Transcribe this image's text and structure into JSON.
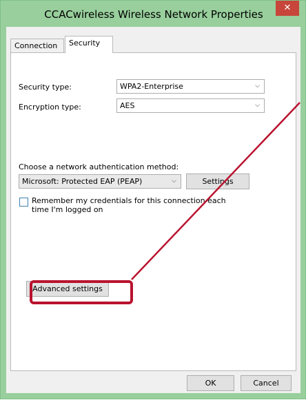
{
  "window": {
    "title": "CCACwireless Wireless Network Properties",
    "close_glyph": "✕"
  },
  "tabs": [
    {
      "label": "Connection"
    },
    {
      "label": "Security"
    }
  ],
  "security": {
    "security_type_label": "Security type:",
    "security_type_value": "WPA2-Enterprise",
    "encryption_type_label": "Encryption type:",
    "encryption_type_value": "AES",
    "auth_method_label": "Choose a network authentication method:",
    "auth_method_value": "Microsoft: Protected EAP (PEAP)",
    "settings_label": "Settings",
    "remember_line1": "Remember my credentials for this connection each",
    "remember_line2": "time I'm logged on",
    "remember_checked": false,
    "advanced_label": "Advanced settings"
  },
  "footer": {
    "ok_label": "OK",
    "cancel_label": "Cancel"
  },
  "colors": {
    "accent_frame": "#98cf9c",
    "highlight": "#b9132f"
  },
  "icons": [
    "close-icon",
    "chevron-down-icon"
  ]
}
